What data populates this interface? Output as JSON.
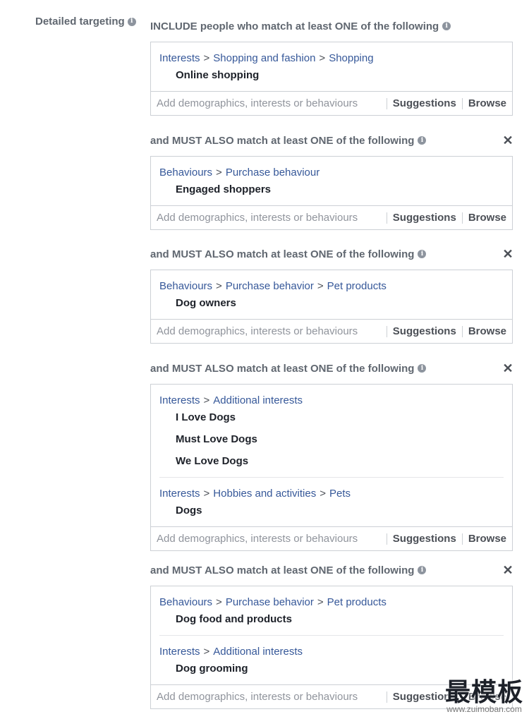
{
  "detailed_targeting_label": "Detailed targeting",
  "info_icon_glyph": "i",
  "close_glyph": "✕",
  "separator": ">",
  "input_placeholder": "Add demographics, interests or behaviours",
  "suggestions_label": "Suggestions",
  "browse_label": "Browse",
  "groups": [
    {
      "heading": "INCLUDE people who match at least ONE of the following",
      "closable": false,
      "sections": [
        {
          "path": [
            "Interests",
            "Shopping and fashion",
            "Shopping"
          ],
          "items": [
            "Online shopping"
          ]
        }
      ]
    },
    {
      "heading": "and MUST ALSO match at least ONE of the following",
      "closable": true,
      "sections": [
        {
          "path": [
            "Behaviours",
            "Purchase behaviour"
          ],
          "items": [
            "Engaged shoppers"
          ]
        }
      ]
    },
    {
      "heading": "and MUST ALSO match at least ONE of the following",
      "closable": true,
      "sections": [
        {
          "path": [
            "Behaviours",
            "Purchase behavior",
            "Pet products"
          ],
          "items": [
            "Dog owners"
          ]
        }
      ]
    },
    {
      "heading": "and MUST ALSO match at least ONE of the following",
      "closable": true,
      "sections": [
        {
          "path": [
            "Interests",
            "Additional interests"
          ],
          "items": [
            "I Love Dogs",
            "Must Love Dogs",
            "We Love Dogs"
          ]
        },
        {
          "path": [
            "Interests",
            "Hobbies and activities",
            "Pets"
          ],
          "items": [
            "Dogs"
          ]
        }
      ]
    },
    {
      "heading": "and MUST ALSO match at least ONE of the following",
      "closable": true,
      "sections": [
        {
          "path": [
            "Behaviours",
            "Purchase behavior",
            "Pet products"
          ],
          "items": [
            "Dog food and products"
          ]
        },
        {
          "path": [
            "Interests",
            "Additional interests"
          ],
          "items": [
            "Dog grooming"
          ]
        }
      ]
    }
  ],
  "watermark": {
    "title": "最模板",
    "url": "www.zuimoban.com"
  }
}
